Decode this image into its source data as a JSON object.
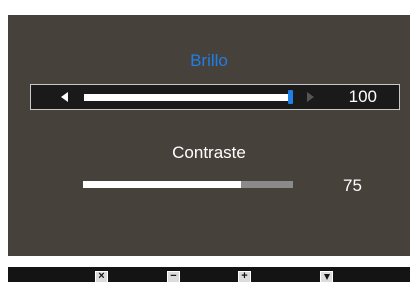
{
  "osd": {
    "brightness": {
      "label": "Brillo",
      "value": "100",
      "level_percent": 100
    },
    "contrast": {
      "label": "Contraste",
      "value": "75",
      "level_percent": 75
    }
  },
  "buttons": {
    "close": {
      "glyph": "×",
      "icon": "close-icon"
    },
    "minus": {
      "glyph": "−",
      "icon": "minus-icon"
    },
    "plus": {
      "glyph": "+",
      "icon": "plus-icon"
    },
    "down": {
      "icon": "down-triangle-icon"
    }
  },
  "colors": {
    "osd_background": "#46413b",
    "selected_label": "#1e7fe6",
    "slider_fill": "#ffffff",
    "slider_track": "#8a8a8a",
    "slider_thumb": "#1e7fe6",
    "button_bar": "#141414"
  }
}
